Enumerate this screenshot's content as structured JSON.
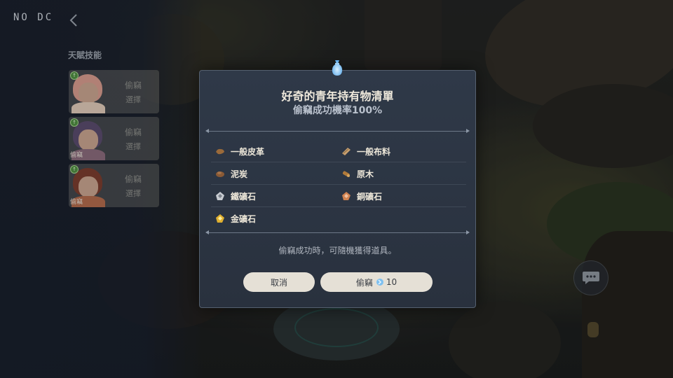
{
  "status": {
    "label": "NO DC"
  },
  "left_panel": {
    "section_title": "天賦技能",
    "cards": [
      {
        "caption": "",
        "action": "偷竊",
        "sub": "選擇",
        "hair": "#d79a8a",
        "body": "#e0c9b5"
      },
      {
        "caption": "偷竊",
        "action": "偷竊",
        "sub": "選擇",
        "hair": "#5a4a6a",
        "body": "#8a6a78"
      },
      {
        "caption": "偷竊",
        "action": "偷竊",
        "sub": "選擇",
        "hair": "#7a3b2a",
        "body": "#b36a48"
      }
    ]
  },
  "modal": {
    "title": "好奇的青年持有物清單",
    "subtitle": "偷竊成功機率100%",
    "items": [
      [
        {
          "name": "一般皮革",
          "icon": "leather-icon",
          "color": "#9a6a3a"
        },
        {
          "name": "一般布料",
          "icon": "cloth-icon",
          "color": "#c8a070"
        }
      ],
      [
        {
          "name": "泥炭",
          "icon": "peat-icon",
          "color": "#8a5a35"
        },
        {
          "name": "原木",
          "icon": "log-icon",
          "color": "#b07a3a"
        }
      ],
      [
        {
          "name": "鐵礦石",
          "icon": "iron-ore-icon",
          "color": "#c8ccd2"
        },
        {
          "name": "銅礦石",
          "icon": "copper-ore-icon",
          "color": "#d08250"
        }
      ],
      [
        {
          "name": "金礦石",
          "icon": "gold-ore-icon",
          "color": "#e0b030"
        },
        null
      ]
    ],
    "note": "偷竊成功時，可隨機獲得道具。",
    "cancel_label": "取消",
    "steal_label": "偷竊",
    "steal_cost": "10"
  },
  "colors": {
    "modal_bg": "#2c3543",
    "button_bg": "#e5e0d6",
    "accent_blue": "#7ec0f0"
  }
}
